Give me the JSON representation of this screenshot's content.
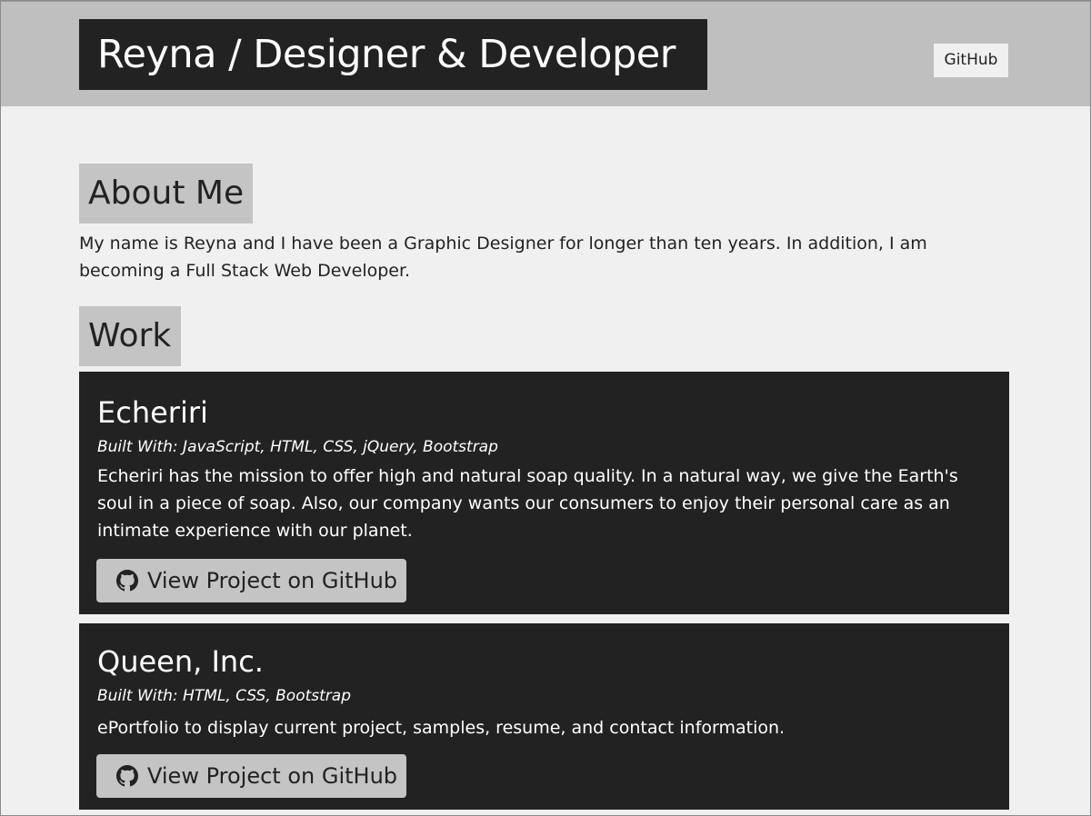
{
  "header": {
    "title": "Reyna / Designer & Developer",
    "github_link": "GitHub"
  },
  "about": {
    "heading": "About Me",
    "text": "My name is Reyna and I have been a Graphic Designer for longer than ten years. In addition, I am becoming a Full Stack Web Developer."
  },
  "work": {
    "heading": "Work",
    "projects": [
      {
        "title": "Echeriri",
        "built_with": "Built With: JavaScript, HTML, CSS, jQuery, Bootstrap",
        "description": "Echeriri has the mission to offer high and natural soap quality. In a natural way, we give the Earth's soul in a piece of soap. Also, our company wants our consumers to enjoy their personal care as an intimate experience with our planet.",
        "button_label": "View Project on GitHub",
        "button_icon": "github-icon"
      },
      {
        "title": "Queen, Inc.",
        "built_with": "Built With: HTML, CSS, Bootstrap",
        "description": "ePortfolio to display current project, samples, resume, and contact information.",
        "button_label": "View Project on GitHub",
        "button_icon": "github-icon"
      }
    ]
  },
  "colors": {
    "header_bg": "#bfbfbf",
    "page_bg": "#f0f0f0",
    "dark": "#222222",
    "heading_bg": "#c4c4c4"
  }
}
